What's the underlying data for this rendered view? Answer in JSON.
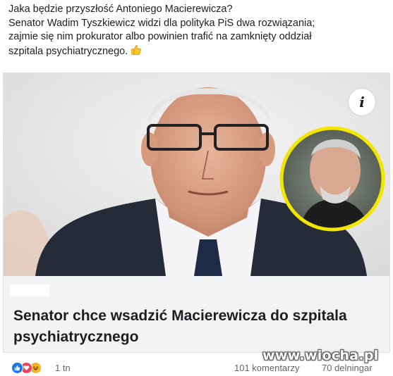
{
  "post": {
    "lines": [
      "Jaka będzie przyszłość Antoniego Macierewicza?",
      "Senator Wadim Tyszkiewicz widzi dla polityka PiS dwa rozwiązania;",
      "zajmie się nim prokurator albo powinien trafić na zamknięty oddział",
      "szpitala psychiatrycznego."
    ],
    "emoji_icon": "thumbs-up-emoji"
  },
  "card": {
    "info_label": "i",
    "headline": "Senator chce wsadzić Macierewicza do szpitala psychiatrycznego",
    "inset_ring_color": "#f2e600"
  },
  "stats": {
    "reactions_count": "1 tn",
    "comments": "101 komentarzy",
    "shares": "70 delningar",
    "reaction_icons": [
      "like-icon",
      "love-icon",
      "haha-icon"
    ],
    "colors": {
      "like": "#1877f2",
      "love": "#f33e58",
      "haha": "#f7b125"
    }
  },
  "watermark": "www.wiocha.pl"
}
